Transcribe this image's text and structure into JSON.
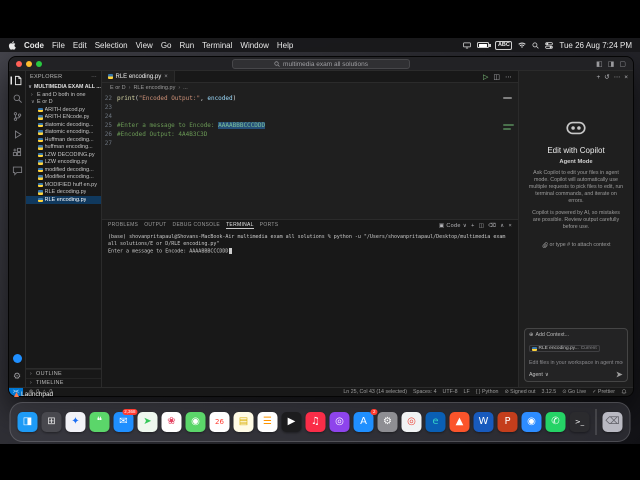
{
  "menubar": {
    "app_name": "Code",
    "menus": [
      "File",
      "Edit",
      "Selection",
      "View",
      "Go",
      "Run",
      "Terminal",
      "Window",
      "Help"
    ],
    "input_source": "ABC",
    "time": "Tue 26 Aug 7:24 PM"
  },
  "titlebar": {
    "search_text": "multimedia exam all solutions"
  },
  "editor_tab": {
    "label": "RLE encoding.py"
  },
  "breadcrumb": {
    "segments": [
      "E or D",
      "RLE encoding.py",
      "..."
    ]
  },
  "explorer": {
    "header": "EXPLORER",
    "root": "MULTIMEDIA EXAM ALL ...",
    "items": [
      {
        "label": "E and D both in one",
        "type": "folder",
        "expanded": false
      },
      {
        "label": "E or D",
        "type": "folder",
        "expanded": true
      },
      {
        "label": "ARITH decod.py",
        "type": "py"
      },
      {
        "label": "ARITH ENcode.py",
        "type": "py"
      },
      {
        "label": "diatomic decoding...",
        "type": "py"
      },
      {
        "label": "diatomic encoding...",
        "type": "py"
      },
      {
        "label": "Huffman decoding...",
        "type": "py"
      },
      {
        "label": "huffman encoding...",
        "type": "py"
      },
      {
        "label": "LZW DECODING.py",
        "type": "py"
      },
      {
        "label": "LZW encoding.py",
        "type": "py"
      },
      {
        "label": "modified decoding...",
        "type": "py"
      },
      {
        "label": "Modified encoding...",
        "type": "py"
      },
      {
        "label": "MODIFIED huff en.py",
        "type": "py"
      },
      {
        "label": "RLE decoding.py",
        "type": "py"
      },
      {
        "label": "RLE encoding.py",
        "type": "py",
        "selected": true
      }
    ],
    "bottom_sections": [
      "OUTLINE",
      "TIMELINE"
    ]
  },
  "editor": {
    "lines": [
      {
        "num": "22",
        "segments": [
          {
            "t": "print",
            "c": "fn"
          },
          {
            "t": "(",
            "c": "plain"
          },
          {
            "t": "\"Encoded Output:\"",
            "c": "str"
          },
          {
            "t": ", ",
            "c": "plain"
          },
          {
            "t": "encoded",
            "c": "var"
          },
          {
            "t": ")",
            "c": "plain"
          }
        ]
      },
      {
        "num": "23",
        "segments": []
      },
      {
        "num": "24",
        "segments": []
      },
      {
        "num": "25",
        "segments": [
          {
            "t": "#Enter a message to Encode: ",
            "c": "comment"
          },
          {
            "t": "AAAABBBCCCDDD",
            "c": "comment-sel"
          }
        ]
      },
      {
        "num": "26",
        "segments": [
          {
            "t": "#Encoded Output: 4A4B3C3D",
            "c": "comment"
          }
        ]
      },
      {
        "num": "27",
        "segments": []
      }
    ]
  },
  "terminal": {
    "tabs": [
      "PROBLEMS",
      "OUTPUT",
      "DEBUG CONSOLE",
      "TERMINAL",
      "PORTS"
    ],
    "active_tab": "TERMINAL",
    "profile": "Code",
    "lines": [
      "(base) shovanpritapaul@Shovans-MacBook-Air multimedia exam all solutions % python -u \"/Users/shovanpritapaul/Desktop/multimedia exam",
      "all solutions/E or D/RLE encoding.py\"",
      "Enter a message to Encode: AAAABBBCCCDDD"
    ],
    "cursor_line": 2
  },
  "copilot": {
    "title": "Edit with Copilot",
    "subtitle": "Agent Mode",
    "body1": "Ask Copilot to edit your files in agent mode. Copilot will automatically use multiple requests to pick files to edit, run terminal commands, and iterate on errors.",
    "body2": "Copilot is powered by AI, so mistakes are possible. Review output carefully before use.",
    "attach_hint": "or type # to attach context",
    "add_context": "Add Context...",
    "context_chip": "RLE encoding.py...",
    "context_chip_note": "Current",
    "input_placeholder": "Edit files in your workspace in agent mode",
    "mode": "Agent"
  },
  "statusbar": {
    "problems": {
      "errors": "0",
      "warnings": "0"
    },
    "items": [
      {
        "label": "Ln 25, Col 43 (14 selected)"
      },
      {
        "label": "Spaces: 4"
      },
      {
        "label": "UTF-8"
      },
      {
        "label": "LF"
      },
      {
        "label": "Python",
        "icon": "braces"
      },
      {
        "label": "Signed out",
        "icon": "person"
      },
      {
        "label": "3.12.5"
      },
      {
        "label": "Go Live",
        "icon": "broadcast"
      },
      {
        "label": "Prettier",
        "icon": "check"
      }
    ]
  },
  "dock": {
    "tooltip": "Launchpad",
    "apps": [
      {
        "name": "finder",
        "bg": "#1e9bf6",
        "fg": "#ffffff",
        "glyph": "◨"
      },
      {
        "name": "launchpad",
        "bg": "#48484e",
        "fg": "#e8e8e8",
        "glyph": "⊞"
      },
      {
        "name": "safari",
        "bg": "#f2f2f7",
        "fg": "#1b6ef3",
        "glyph": "✦"
      },
      {
        "name": "messages",
        "bg": "#5bd66a",
        "fg": "#ffffff",
        "glyph": "❝"
      },
      {
        "name": "mail",
        "bg": "#1f8fff",
        "fg": "#ffffff",
        "glyph": "✉",
        "badge": "2,368"
      },
      {
        "name": "maps",
        "bg": "#eef7ee",
        "fg": "#34c759",
        "glyph": "➤"
      },
      {
        "name": "photos",
        "bg": "#ffffff",
        "fg": "#e4405f",
        "glyph": "❀"
      },
      {
        "name": "facetime",
        "bg": "#5bd66a",
        "fg": "#ffffff",
        "glyph": "◉"
      },
      {
        "name": "calendar",
        "bg": "#ffffff",
        "fg": "#ff3b30",
        "glyph": "26"
      },
      {
        "name": "notes",
        "bg": "#fffbe6",
        "fg": "#d9ae00",
        "glyph": "▤"
      },
      {
        "name": "reminders",
        "bg": "#ffffff",
        "fg": "#ff9500",
        "glyph": "☰"
      },
      {
        "name": "tv",
        "bg": "#1c1c1e",
        "fg": "#ffffff",
        "glyph": "▶"
      },
      {
        "name": "music",
        "bg": "#fa2d48",
        "fg": "#ffffff",
        "glyph": "♫"
      },
      {
        "name": "podcasts",
        "bg": "#8e44ec",
        "fg": "#ffffff",
        "glyph": "◎"
      },
      {
        "name": "app-store",
        "bg": "#1f8fff",
        "fg": "#ffffff",
        "glyph": "A",
        "badge": "2"
      },
      {
        "name": "settings",
        "bg": "#8e8e93",
        "fg": "#ffffff",
        "glyph": "⚙"
      },
      {
        "name": "chrome",
        "bg": "#f1f3f4",
        "fg": "#ea4335",
        "glyph": "◎"
      },
      {
        "name": "edge",
        "bg": "#0a5fb4",
        "fg": "#35d0c8",
        "glyph": "e"
      },
      {
        "name": "brave",
        "bg": "#fb542b",
        "fg": "#ffffff",
        "glyph": "▲"
      },
      {
        "name": "word",
        "bg": "#185abd",
        "fg": "#ffffff",
        "glyph": "W"
      },
      {
        "name": "powerpoint",
        "bg": "#c43e1c",
        "fg": "#ffffff",
        "glyph": "P"
      },
      {
        "name": "zoom",
        "bg": "#2d8cff",
        "fg": "#ffffff",
        "glyph": "◉"
      },
      {
        "name": "whatsapp",
        "bg": "#25d366",
        "fg": "#ffffff",
        "glyph": "✆"
      },
      {
        "name": "terminal-app",
        "bg": "#2b2b2e",
        "fg": "#ffffff",
        "glyph": ">_"
      },
      {
        "name": "trash",
        "bg": "#b9b9c2",
        "fg": "#5f5f66",
        "glyph": "⌫"
      }
    ]
  }
}
